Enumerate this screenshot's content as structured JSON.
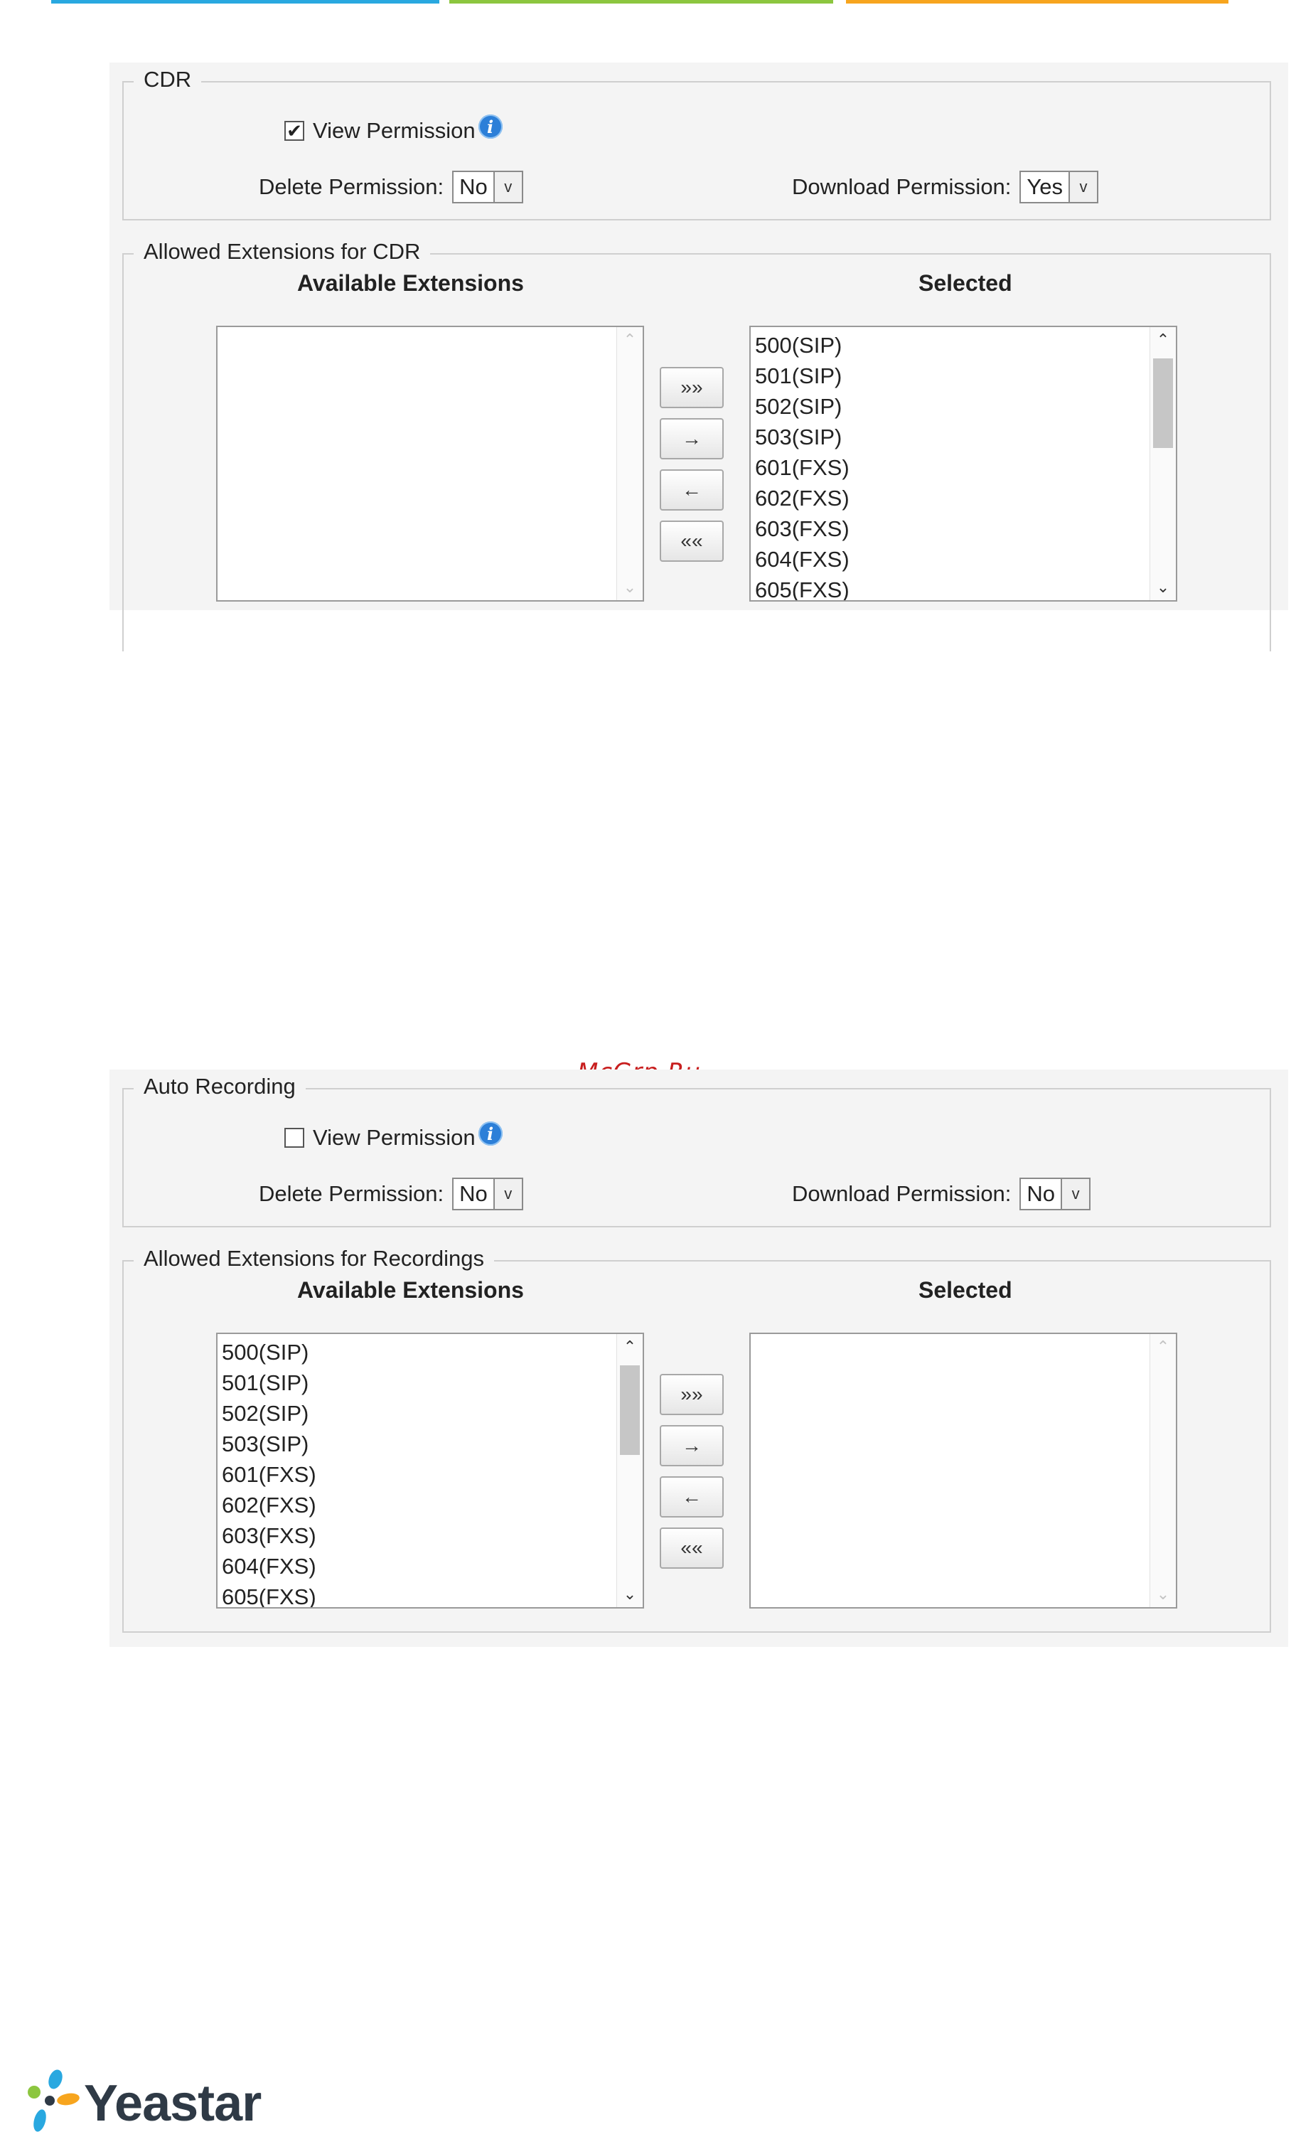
{
  "colors": {
    "bar_blue": "#29a8e0",
    "bar_green": "#8cc63f",
    "bar_orange": "#f7a51e",
    "info_blue": "#2c7fd8",
    "watermark_red": "#c81e1e"
  },
  "cdr": {
    "legend": "CDR",
    "view_permission_label": "View Permission",
    "view_permission_checked": true,
    "delete_label": "Delete Permission:",
    "delete_value": "No",
    "download_label": "Download Permission:",
    "download_value": "Yes",
    "allowed_legend": "Allowed Extensions for CDR",
    "available_header": "Available Extensions",
    "selected_header": "Selected",
    "available": [],
    "selected": [
      "500(SIP)",
      "501(SIP)",
      "502(SIP)",
      "503(SIP)",
      "601(FXS)",
      "602(FXS)",
      "603(FXS)",
      "604(FXS)",
      "605(FXS)"
    ]
  },
  "auto_recording": {
    "legend": "Auto Recording",
    "view_permission_label": "View Permission",
    "view_permission_checked": false,
    "delete_label": "Delete Permission:",
    "delete_value": "No",
    "download_label": "Download Permission:",
    "download_value": "No",
    "allowed_legend": "Allowed Extensions for Recordings",
    "available_header": "Available Extensions",
    "selected_header": "Selected",
    "available": [
      "500(SIP)",
      "501(SIP)",
      "502(SIP)",
      "503(SIP)",
      "601(FXS)",
      "602(FXS)",
      "603(FXS)",
      "604(FXS)",
      "605(FXS)"
    ],
    "selected": []
  },
  "buttons": {
    "add_all": "»»",
    "add": "→",
    "remove": "←",
    "remove_all": "««"
  },
  "scroll": {
    "up": "⌃",
    "down": "⌄"
  },
  "select_arrow": "v",
  "checkmark": "✔",
  "info_glyph": "i",
  "watermark": "McGrp.Ru",
  "logo": {
    "text": "Yeastar",
    "icon": "yeastar-logo-icon"
  }
}
